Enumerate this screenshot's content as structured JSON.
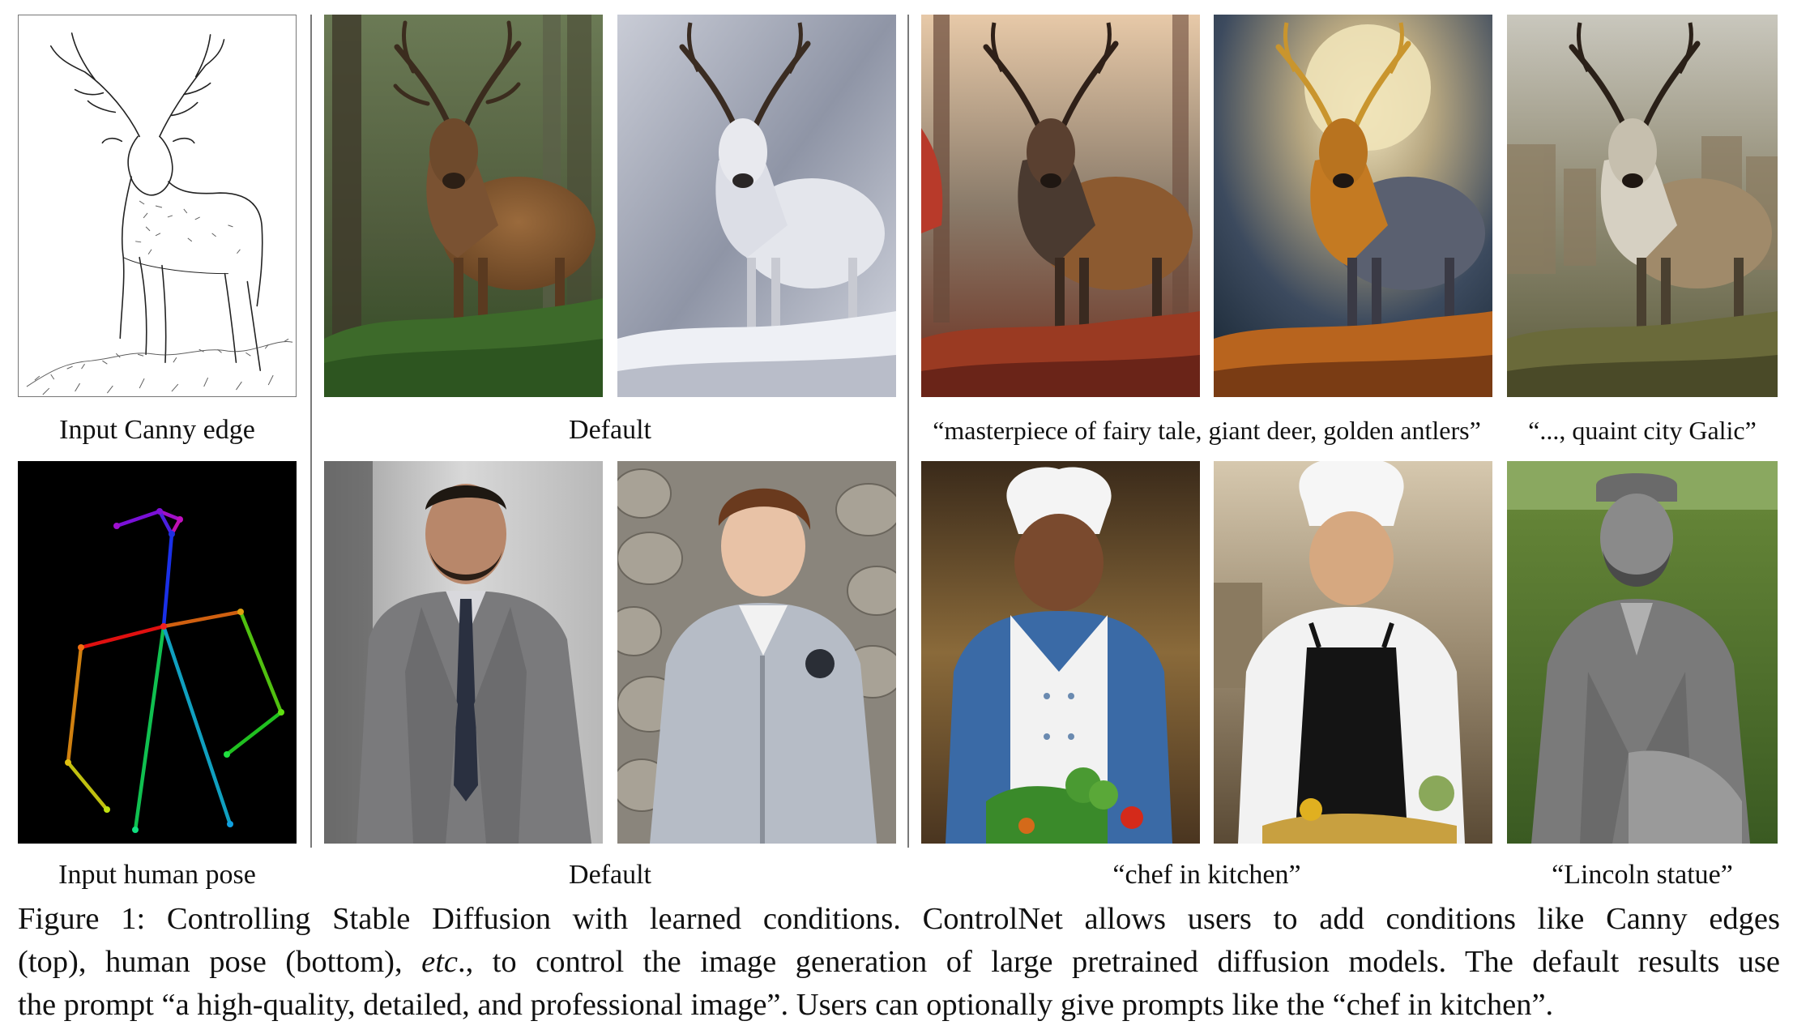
{
  "panels": {
    "canny": {
      "caption": "Input Canny edge"
    },
    "top_default": {
      "caption": "Default"
    },
    "top_prompt1": {
      "caption": "“masterpiece of fairy tale, giant deer, golden antlers”"
    },
    "top_prompt2": {
      "caption": "“..., quaint city Galic”"
    },
    "pose": {
      "caption": "Input human pose"
    },
    "bottom_default": {
      "caption": "Default"
    },
    "bottom_prompt1": {
      "caption": "“chef in kitchen”"
    },
    "bottom_prompt2": {
      "caption": "“Lincoln statue”"
    }
  },
  "figure_caption": {
    "line1": "Figure 1: Controlling Stable Diffusion with learned conditions. ControlNet allows users to add conditions like Canny edges",
    "line2_a": "(top), human pose (bottom), ",
    "line2_etc": "etc",
    "line2_b": "., to control the image generation of large pretrained diffusion models. The default results use",
    "line3": "the prompt “a high-quality, detailed, and professional image”. Users can optionally give prompts like the “chef in kitchen”."
  },
  "colors": {
    "divider": "#7a7a7a",
    "pose_background": "#000000"
  }
}
